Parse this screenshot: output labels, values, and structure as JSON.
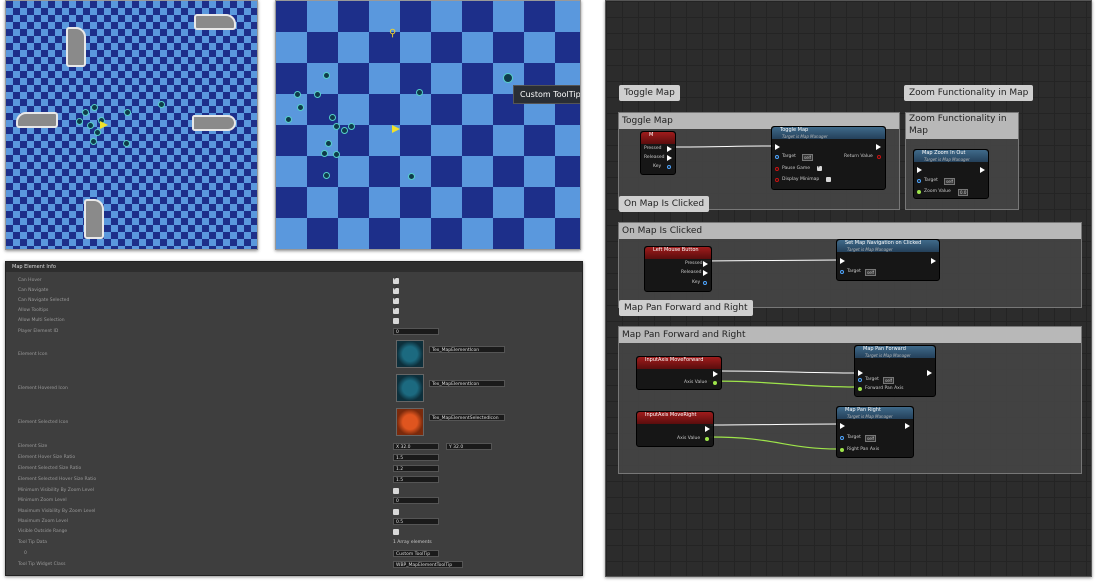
{
  "map2": {
    "tooltip": "Custom ToolTip"
  },
  "details": {
    "header": "Map Element Info",
    "rows": [
      {
        "label": "Can Hover"
      },
      {
        "label": "Can Navigate"
      },
      {
        "label": "Can Navigate Selected"
      },
      {
        "label": "Allow Tooltips"
      },
      {
        "label": "Allow Multi Selection"
      },
      {
        "label": "Player Element ID"
      },
      {
        "label": "Element Icon"
      },
      {
        "label": "Element Hovered Icon"
      },
      {
        "label": "Element Selected Icon"
      },
      {
        "label": "Element Size"
      },
      {
        "label": "Element Hover Size Ratio"
      },
      {
        "label": "Element Selected Size Ratio"
      },
      {
        "label": "Element Selected Hover Size Ratio"
      },
      {
        "label": "Minimum Visibility By Zoom Level"
      },
      {
        "label": "Minimum Zoom Level"
      },
      {
        "label": "Maximum Visibility By Zoom Level"
      },
      {
        "label": "Maximum Zoom Level"
      },
      {
        "label": "Visible Outside Range"
      },
      {
        "label": "Tool Tip Data"
      },
      {
        "label": "0"
      },
      {
        "label": "Tool Tip Widget Class"
      }
    ],
    "values": {
      "player_id": "0",
      "icon_tex": "Tex_MapElementIcon",
      "hovered_tex": "Tex_MapElementIcon",
      "selected_tex": "Tex_MapElementSelectedIcon",
      "size_x": "X 32.0",
      "size_y": "Y 32.0",
      "hover_ratio": "1.5",
      "selected_ratio": "1.2",
      "selected_hover_ratio": "1.5",
      "min_zoom": "0",
      "max_zoom": "0.5",
      "tooltip_count": "1 Array elements",
      "tooltip_item": "Custom ToolTip",
      "widget_class": "WBP_MapElementToolTip"
    }
  },
  "graph": {
    "comments": [
      {
        "bubble": "Toggle Map",
        "title": "Toggle Map"
      },
      {
        "bubble": "Zoom Functionality in Map",
        "title": "Zoom Functionality in Map"
      },
      {
        "bubble": "On Map Is Clicked",
        "title": "On Map Is Clicked"
      },
      {
        "bubble": "Map Pan Forward and Right",
        "title": "Map Pan Forward and Right"
      }
    ],
    "nodes": {
      "m_key": {
        "title": "M",
        "pins": [
          "Pressed",
          "Released",
          "Key"
        ]
      },
      "toggle_map": {
        "title": "Toggle Map",
        "sub": "Target is Map Manager",
        "pins": [
          "Target",
          "Pause Game",
          "Display Minimap"
        ],
        "out": "Return Value",
        "self": "self"
      },
      "zoom": {
        "title": "Map Zoom In Out",
        "sub": "Target is Map Manager",
        "pins": [
          "Target",
          "Zoom Value"
        ],
        "self": "self",
        "zoom_val": "0.0"
      },
      "lmb": {
        "title": "Left Mouse Button",
        "pins": [
          "Pressed",
          "Released",
          "Key"
        ]
      },
      "set_nav": {
        "title": "Set Map Navigation on Clicked",
        "sub": "Target is Map Manager",
        "pins": [
          "Target"
        ],
        "self": "self"
      },
      "axis_fwd": {
        "title": "InputAxis MoveForward",
        "pin": "Axis Value"
      },
      "pan_fwd": {
        "title": "Map Pan Forward",
        "sub": "Target is Map Manager",
        "pins": [
          "Target",
          "Forward Pan Axis"
        ],
        "self": "self"
      },
      "axis_right": {
        "title": "InputAxis MoveRight",
        "pin": "Axis Value"
      },
      "pan_right": {
        "title": "Map Pan Right",
        "sub": "Target is Map Manager",
        "pins": [
          "Target",
          "Right Pan Axis"
        ],
        "self": "self"
      }
    }
  }
}
